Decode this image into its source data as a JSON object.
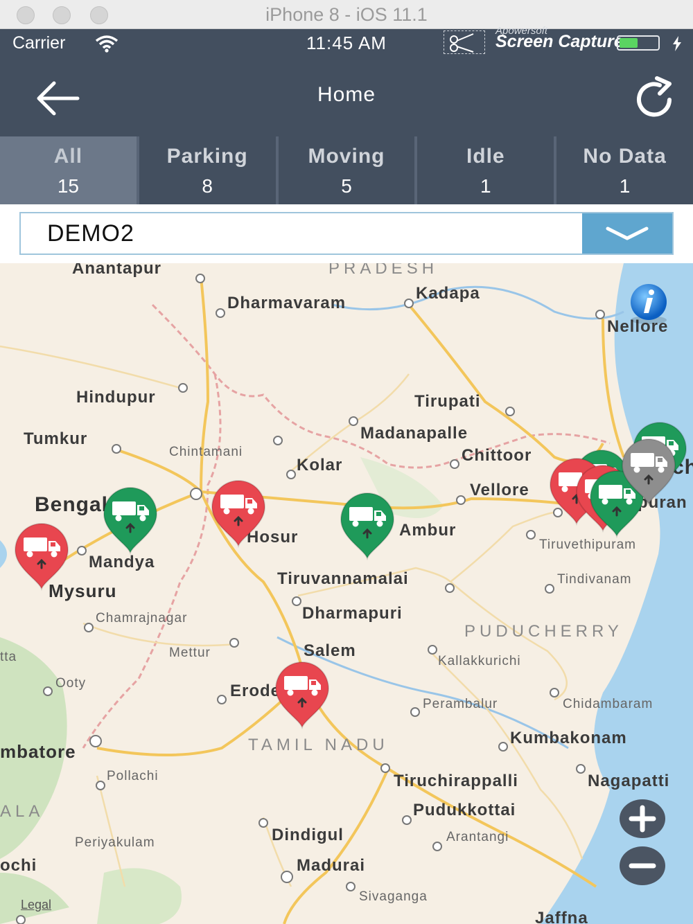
{
  "simulator": {
    "title": "iPhone 8 - iOS 11.1"
  },
  "status_bar": {
    "carrier": "Carrier",
    "time": "11:45 AM",
    "overlay_small": "Apowersoft",
    "overlay_big": "Screen Capture",
    "battery_level": 0.45
  },
  "nav": {
    "title": "Home",
    "back_icon": "arrow-left-icon",
    "refresh_icon": "refresh-icon"
  },
  "tabs": [
    {
      "label": "All",
      "count": "15"
    },
    {
      "label": "Parking",
      "count": "8"
    },
    {
      "label": "Moving",
      "count": "5"
    },
    {
      "label": "Idle",
      "count": "1"
    },
    {
      "label": "No Data",
      "count": "1"
    }
  ],
  "selector": {
    "value": "DEMO2",
    "icon": "chevron-down-icon"
  },
  "colors": {
    "header": "#434f5f",
    "tab_active": "#6c7889",
    "dropdown": "#5fa6cf",
    "parking": "#e8464f",
    "moving": "#1f9a5a",
    "nodata": "#8e8e8e"
  },
  "map": {
    "labels": {
      "anantapur": "Anantapur",
      "pradesh": "PRADESH",
      "kadapa": "Kadapa",
      "dharmavaram": "Dharmavaram",
      "nellore": "Nellore",
      "hindupur": "Hindupur",
      "tirupati": "Tirupati",
      "tumkur": "Tumkur",
      "madanapalle": "Madanapalle",
      "chintamani": "Chintamani",
      "chittoor": "Chittoor",
      "kolar": "Kolar",
      "bengaluru": "Bengaluru",
      "vellore": "Vellore",
      "hosur": "Hosur",
      "ambur": "Ambur",
      "mandya": "Mandya",
      "tiruvethipuram": "Tiruvethipuram",
      "tiruvannamalai": "Tiruvannamalai",
      "tindivanam": "Tindivanam",
      "mysuru": "Mysuru",
      "chamrajnagar": "Chamrajnagar",
      "dharmapuri": "Dharmapuri",
      "puducherry": "PUDUCHERRY",
      "mettur": "Mettur",
      "salem": "Salem",
      "kallakkurichi": "Kallakkurichi",
      "ooty": "Ooty",
      "erode": "Erode",
      "perambalur": "Perambalur",
      "chidambaram": "Chidambaram",
      "tamil_nadu": "TAMIL NADU",
      "kumbakonam": "Kumbakonam",
      "coimbatore": "mbatore",
      "pollachi": "Pollachi",
      "tiruchirappalli": "Tiruchirappalli",
      "nagapatti": "Nagapatti",
      "kerala": "ALA",
      "pudukkottai": "Pudukkottai",
      "dindigul": "Dindigul",
      "arantangi": "Arantangi",
      "periyakulam": "Periyakulam",
      "kochi": "ochi",
      "madurai": "Madurai",
      "sivaganga": "Sivaganga",
      "jaffna": "Jaffna",
      "tta": "tta",
      "puram": "puran",
      "ch": "ch"
    },
    "legal": "Legal",
    "markers": [
      {
        "status": "parking",
        "icon": "truck-icon"
      },
      {
        "status": "moving",
        "icon": "truck-icon"
      },
      {
        "status": "parking",
        "icon": "truck-icon"
      },
      {
        "status": "moving",
        "icon": "truck-icon"
      },
      {
        "status": "parking",
        "icon": "truck-icon"
      },
      {
        "status": "moving",
        "icon": "truck-icon"
      },
      {
        "status": "moving",
        "icon": "truck-icon"
      },
      {
        "status": "parking",
        "icon": "truck-icon"
      },
      {
        "status": "parking",
        "icon": "truck-icon"
      },
      {
        "status": "moving",
        "icon": "truck-icon"
      },
      {
        "status": "nodata",
        "icon": "truck-icon"
      }
    ],
    "info_icon": "info-icon",
    "zoom_in_icon": "plus-icon",
    "zoom_out_icon": "minus-icon"
  }
}
